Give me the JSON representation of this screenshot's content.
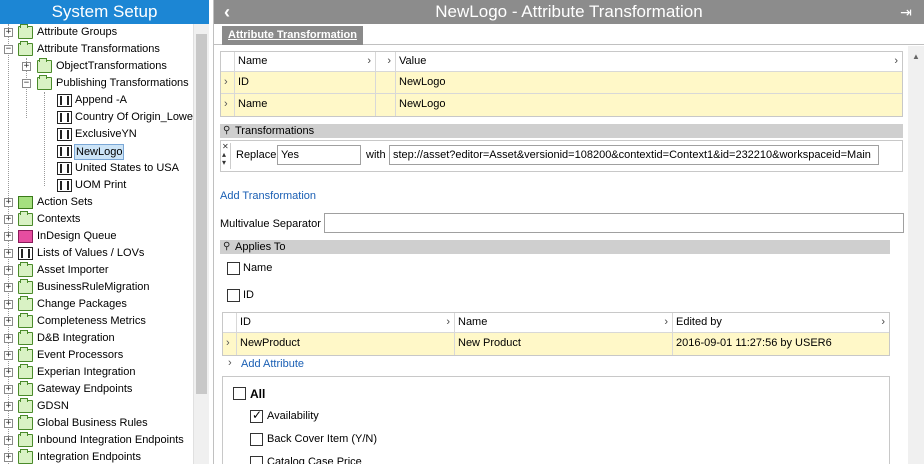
{
  "left_panel": {
    "title": "System Setup",
    "tree": [
      {
        "label": "Attribute Groups"
      },
      {
        "label": "Attribute Transformations"
      },
      {
        "label": "ObjectTransformations"
      },
      {
        "label": "Publishing Transformations"
      },
      {
        "label": "Append -A"
      },
      {
        "label": "Country Of Origin_Lowe"
      },
      {
        "label": "ExclusiveYN"
      },
      {
        "label": "NewLogo"
      },
      {
        "label": "United States to USA"
      },
      {
        "label": "UOM Print"
      },
      {
        "label": "Action Sets"
      },
      {
        "label": "Contexts"
      },
      {
        "label": "InDesign Queue"
      },
      {
        "label": "Lists of Values / LOVs"
      },
      {
        "label": "Asset Importer"
      },
      {
        "label": "BusinessRuleMigration"
      },
      {
        "label": "Change Packages"
      },
      {
        "label": "Completeness Metrics"
      },
      {
        "label": "D&B Integration"
      },
      {
        "label": "Event Processors"
      },
      {
        "label": "Experian Integration"
      },
      {
        "label": "Gateway Endpoints"
      },
      {
        "label": "GDSN"
      },
      {
        "label": "Global Business Rules"
      },
      {
        "label": "Inbound Integration Endpoints"
      },
      {
        "label": "Integration Endpoints"
      }
    ]
  },
  "editor": {
    "title": "NewLogo - Attribute Transformation",
    "tab": "Attribute Transformation",
    "props_table": {
      "headers": [
        "Name",
        "Value"
      ],
      "rows": [
        {
          "name": "ID",
          "value": "NewLogo"
        },
        {
          "name": "Name",
          "value": "NewLogo"
        }
      ]
    },
    "transformations": {
      "section_label": "Transformations",
      "replace_label": "Replace",
      "replace_value": "Yes",
      "with_label": "with",
      "with_value": "step://asset?editor=Asset&versionid=108200&contextid=Context1&id=232210&workspaceid=Main",
      "add_link": "Add Transformation"
    },
    "multivalue_separator": {
      "label": "Multivalue Separator",
      "value": ""
    },
    "applies_to": {
      "section_label": "Applies To",
      "name_checkbox": "Name",
      "id_checkbox": "ID",
      "table": {
        "headers": [
          "ID",
          "Name",
          "Edited by"
        ],
        "rows": [
          {
            "id": "NewProduct",
            "name": "New Product",
            "edited_by": "2016-09-01 11:27:56 by USER6"
          }
        ]
      },
      "add_attribute_link": "Add Attribute",
      "all_label": "All",
      "options": [
        {
          "label": "Availability",
          "checked": true
        },
        {
          "label": "Back Cover Item (Y/N)",
          "checked": false
        },
        {
          "label": "Catalog Case Price",
          "checked": false
        }
      ]
    }
  },
  "colors": {
    "left_title_bg": "#1c86d4",
    "right_title_bg": "#8c8c8c",
    "row_highlight": "#fff8c8",
    "link": "#1a5fb4"
  }
}
